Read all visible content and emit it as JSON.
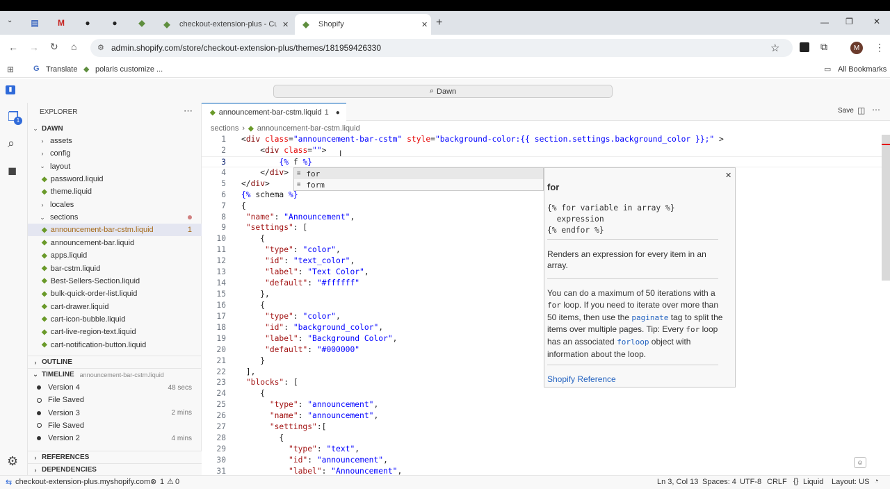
{
  "browser": {
    "tabs": [
      {
        "label": "checkout-extension-plus - Cust"
      },
      {
        "label": "Shopify"
      }
    ],
    "url": "admin.shopify.com/store/checkout-extension-plus/themes/181959426330",
    "profile_initial": "M",
    "bookmarks": [
      {
        "label": "Translate"
      },
      {
        "label": "polaris customize ..."
      }
    ],
    "all_bookmarks": "All Bookmarks"
  },
  "ide": {
    "search": "Dawn",
    "explorer_title": "EXPLORER",
    "root": "DAWN",
    "tree": [
      {
        "label": "assets",
        "type": "folder",
        "open": false
      },
      {
        "label": "config",
        "type": "folder",
        "open": false
      },
      {
        "label": "layout",
        "type": "folder",
        "open": true
      },
      {
        "label": "password.liquid",
        "type": "file"
      },
      {
        "label": "theme.liquid",
        "type": "file"
      },
      {
        "label": "locales",
        "type": "folder",
        "open": false
      },
      {
        "label": "sections",
        "type": "folder",
        "open": true
      },
      {
        "label": "announcement-bar-cstm.liquid",
        "type": "file",
        "badge": "1"
      },
      {
        "label": "announcement-bar.liquid",
        "type": "file"
      },
      {
        "label": "apps.liquid",
        "type": "file"
      },
      {
        "label": "bar-cstm.liquid",
        "type": "file"
      },
      {
        "label": "Best-Sellers-Section.liquid",
        "type": "file"
      },
      {
        "label": "bulk-quick-order-list.liquid",
        "type": "file"
      },
      {
        "label": "cart-drawer.liquid",
        "type": "file"
      },
      {
        "label": "cart-icon-bubble.liquid",
        "type": "file"
      },
      {
        "label": "cart-live-region-text.liquid",
        "type": "file"
      },
      {
        "label": "cart-notification-button.liquid",
        "type": "file"
      }
    ],
    "outline": "OUTLINE",
    "timeline": "TIMELINE",
    "timeline_file": "announcement-bar-cstm.liquid",
    "timeline_items": [
      {
        "label": "Version 4",
        "time": "48 secs",
        "kind": "dot"
      },
      {
        "label": "File Saved",
        "time": "",
        "kind": "circ"
      },
      {
        "label": "Version 3",
        "time": "2 mins",
        "kind": "dot"
      },
      {
        "label": "File Saved",
        "time": "",
        "kind": "circ"
      },
      {
        "label": "Version 2",
        "time": "4 mins",
        "kind": "dot"
      }
    ],
    "references": "REFERENCES",
    "dependencies": "DEPENDENCIES",
    "editor_tab": "announcement-bar-cstm.liquid",
    "editor_tab_badge": "1",
    "save": "Save",
    "breadcrumb": [
      "sections",
      "announcement-bar-cstm.liquid"
    ],
    "suggestions": [
      "for",
      "form"
    ],
    "doc": {
      "title": "for",
      "syntax": [
        "{% for variable in array %}",
        "  expression",
        "{% endfor %}"
      ],
      "desc": "Renders an expression for every item in an array.",
      "p2a": "You can do a maximum of 50 iterations with a ",
      "p2b": "for",
      "p2c": " loop. If you need to iterate over more than 50 items, then use the ",
      "p2d": "paginate",
      "p2e": " tag to split the items over multiple pages. Tip: Every ",
      "p2f": "for",
      "p2g": " loop has an associated ",
      "p2h": "forloop",
      "p2i": " object with information about the loop.",
      "link": "Shopify Reference"
    },
    "status": {
      "host": "checkout-extension-plus.myshopify.com",
      "errors": "1",
      "warnings": "0",
      "position": "Ln 3, Col 13",
      "spaces": "Spaces: 4",
      "encoding": "UTF-8",
      "eol": "CRLF",
      "language": "Liquid",
      "layout": "Layout: US"
    }
  },
  "code_lines": [
    "<div class=\"announcement-bar-cstm\" style=\"background-color:{{ section.settings.background_color }};\" >",
    "    <div class=\"\">",
    "        {% f %}",
    "    </div>",
    "</div>",
    "{% schema %}",
    "{",
    " \"name\": \"Announcement\",",
    " \"settings\": [",
    "    {",
    "     \"type\": \"color\",",
    "     \"id\": \"text_color\",",
    "     \"label\": \"Text Color\",",
    "     \"default\": \"#ffffff\"",
    "    },",
    "    {",
    "     \"type\": \"color\",",
    "     \"id\": \"background_color\",",
    "     \"label\": \"Background Color\",",
    "     \"default\": \"#000000\"",
    "    }",
    " ],",
    " \"blocks\": [",
    "    {",
    "      \"type\": \"announcement\",",
    "      \"name\": \"announcement\",",
    "      \"settings\":[",
    "        {",
    "          \"type\": \"text\",",
    "          \"id\": \"announcement\",",
    "          \"label\": \"Announcement\","
  ]
}
